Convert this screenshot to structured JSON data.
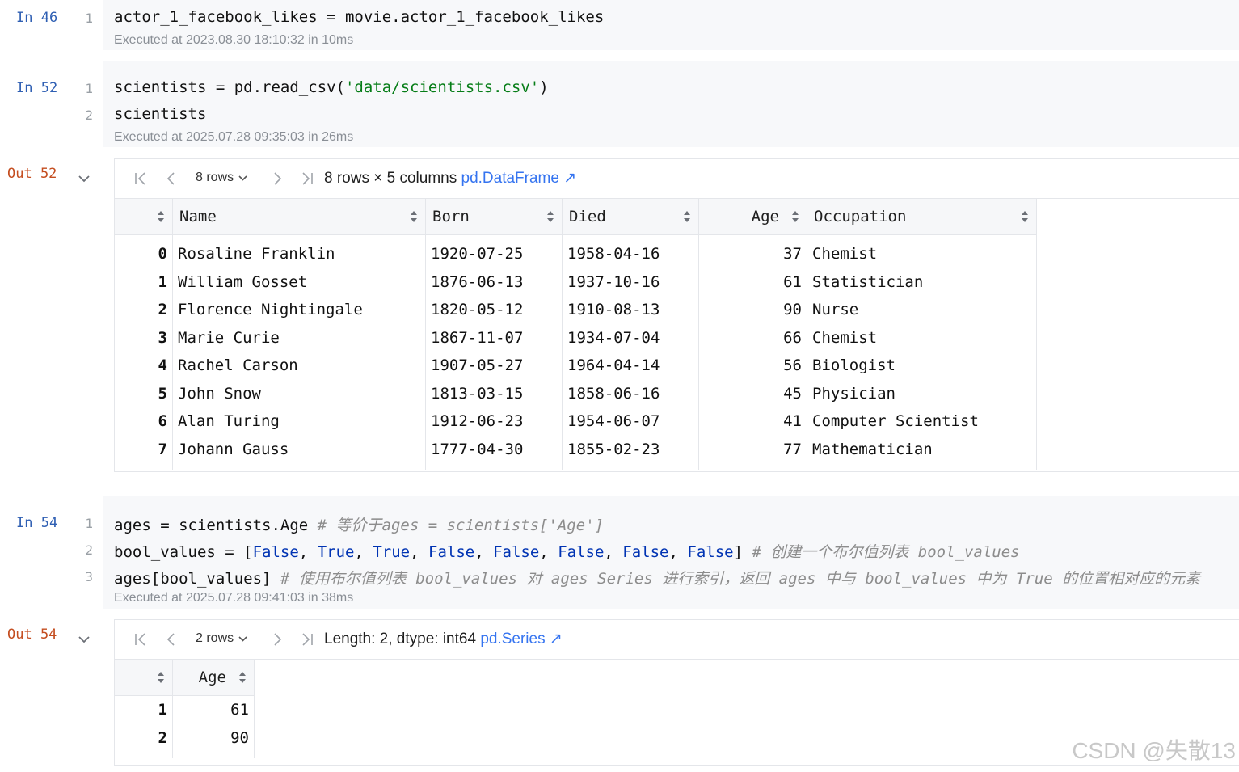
{
  "cells": {
    "c46": {
      "prompt": "In 46",
      "lines": [
        "1"
      ],
      "code1": "actor_1_facebook_likes = movie.actor_1_facebook_likes",
      "exec": "Executed at 2023.08.30 18:10:32 in 10ms"
    },
    "c52": {
      "prompt": "In 52",
      "code1_a": "scientists = pd.read_csv(",
      "code1_str": "'data/scientists.csv'",
      "code1_b": ")",
      "code2": "scientists",
      "exec": "Executed at 2025.07.28 09:35:03 in 26ms"
    },
    "out52": {
      "prompt": "Out 52",
      "rows_select": "8 rows",
      "summary": "8 rows × 5 columns ",
      "link": "pd.DataFrame ↗",
      "columns": [
        "Name",
        "Born",
        "Died",
        "Age",
        "Occupation"
      ],
      "rows": [
        {
          "idx": "0",
          "Name": "Rosaline Franklin",
          "Born": "1920-07-25",
          "Died": "1958-04-16",
          "Age": "37",
          "Occupation": "Chemist"
        },
        {
          "idx": "1",
          "Name": "William Gosset",
          "Born": "1876-06-13",
          "Died": "1937-10-16",
          "Age": "61",
          "Occupation": "Statistician"
        },
        {
          "idx": "2",
          "Name": "Florence Nightingale",
          "Born": "1820-05-12",
          "Died": "1910-08-13",
          "Age": "90",
          "Occupation": "Nurse"
        },
        {
          "idx": "3",
          "Name": "Marie Curie",
          "Born": "1867-11-07",
          "Died": "1934-07-04",
          "Age": "66",
          "Occupation": "Chemist"
        },
        {
          "idx": "4",
          "Name": "Rachel Carson",
          "Born": "1907-05-27",
          "Died": "1964-04-14",
          "Age": "56",
          "Occupation": "Biologist"
        },
        {
          "idx": "5",
          "Name": "John Snow",
          "Born": "1813-03-15",
          "Died": "1858-06-16",
          "Age": "45",
          "Occupation": "Physician"
        },
        {
          "idx": "6",
          "Name": "Alan Turing",
          "Born": "1912-06-23",
          "Died": "1954-06-07",
          "Age": "41",
          "Occupation": "Computer Scientist"
        },
        {
          "idx": "7",
          "Name": "Johann Gauss",
          "Born": "1777-04-30",
          "Died": "1855-02-23",
          "Age": "77",
          "Occupation": "Mathematician"
        }
      ]
    },
    "c54": {
      "prompt": "In 54",
      "l1_code": "ages = scientists.Age ",
      "l1_cmt": "# 等价于ages = scientists['Age']",
      "l2_a": "bool_values = [",
      "l2_vals": [
        "False",
        "True",
        "True",
        "False",
        "False",
        "False",
        "False",
        "False"
      ],
      "l2_b": "] ",
      "l2_cmt": "# 创建一个布尔值列表 bool_values",
      "l3_code": "ages[bool_values] ",
      "l3_cmt": "# 使用布尔值列表 bool_values 对 ages Series 进行索引，返回 ages 中与 bool_values 中为 True 的位置相对应的元素",
      "exec": "Executed at 2025.07.28 09:41:03 in 38ms"
    },
    "out54": {
      "prompt": "Out 54",
      "rows_select": "2 rows",
      "summary": "Length: 2, dtype: int64 ",
      "link": "pd.Series ↗",
      "column": "Age",
      "rows": [
        {
          "idx": "1",
          "Age": "61"
        },
        {
          "idx": "2",
          "Age": "90"
        }
      ]
    }
  },
  "line_numbers": [
    "1",
    "2",
    "3"
  ],
  "watermark": "CSDN @失散13",
  "colors": {
    "prompt_in": "#2f5fb3",
    "prompt_out": "#c44d1f",
    "string": "#067d17",
    "keyword": "#0033b3",
    "comment": "#8c8c8c",
    "link": "#3574f0"
  }
}
